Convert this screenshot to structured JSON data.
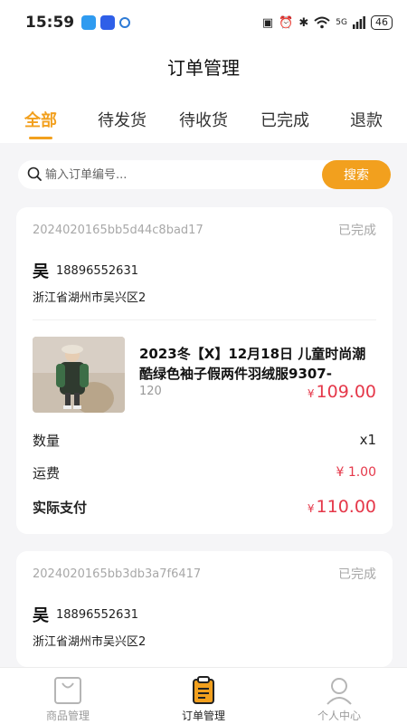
{
  "status_bar": {
    "time": "15:59",
    "network": "5G",
    "battery": "46"
  },
  "header": {
    "title": "订单管理"
  },
  "tabs": [
    {
      "label": "全部",
      "active": true
    },
    {
      "label": "待发货",
      "active": false
    },
    {
      "label": "待收货",
      "active": false
    },
    {
      "label": "已完成",
      "active": false
    },
    {
      "label": "退款",
      "active": false
    }
  ],
  "search": {
    "placeholder": "输入订单编号...",
    "button_label": "搜索"
  },
  "orders": [
    {
      "order_no": "2024020165bb5d44c8bad17",
      "status": "已完成",
      "customer_name": "吴",
      "phone": "18896552631",
      "address": "浙江省湖州市吴兴区2",
      "product_name": "2023冬【X】12月18日 儿童时尚潮酷绿色袖子假两件羽绒服9307-",
      "product_spec": "120",
      "currency": "¥",
      "product_price": "109.00",
      "qty_label": "数量",
      "qty_value": "x1",
      "shipping_label": "运费",
      "shipping_value": "¥ 1.00",
      "total_label": "实际支付",
      "total_value": "110.00"
    },
    {
      "order_no": "2024020165bb3db3a7f6417",
      "status": "已完成",
      "customer_name": "吴",
      "phone": "18896552631",
      "address": "浙江省湖州市吴兴区2"
    }
  ],
  "bottom_nav": [
    {
      "label": "商品管理",
      "icon": "shopping-bag-icon",
      "active": false
    },
    {
      "label": "订单管理",
      "icon": "clipboard-icon",
      "active": true
    },
    {
      "label": "个人中心",
      "icon": "user-icon",
      "active": false
    }
  ],
  "colors": {
    "accent": "#f2a01e",
    "price": "#e5384a"
  }
}
